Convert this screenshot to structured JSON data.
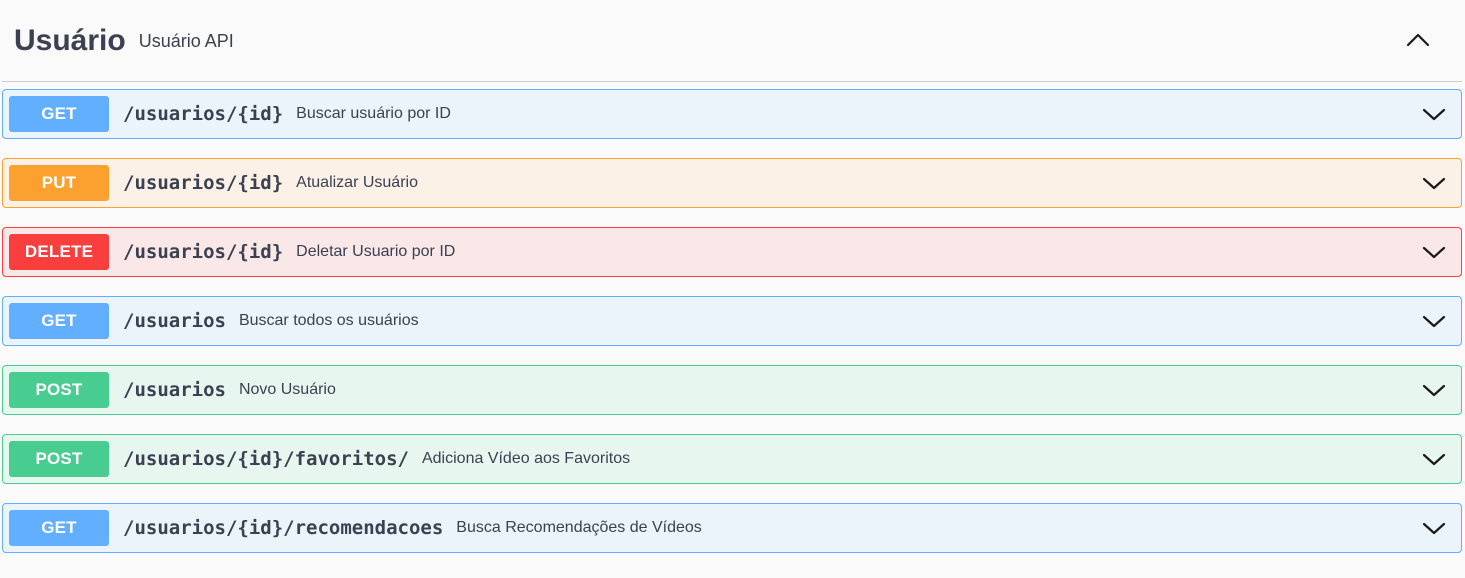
{
  "tag": {
    "name": "Usuário",
    "description": "Usuário API",
    "expanded": true
  },
  "colors": {
    "get": "#61affe",
    "put": "#fca130",
    "delete": "#f93e3e",
    "post": "#49cc90"
  },
  "operations": [
    {
      "method": "GET",
      "path": "/usuarios/{id}",
      "summary": "Buscar usuário por ID"
    },
    {
      "method": "PUT",
      "path": "/usuarios/{id}",
      "summary": "Atualizar Usuário"
    },
    {
      "method": "DELETE",
      "path": "/usuarios/{id}",
      "summary": "Deletar Usuario por ID"
    },
    {
      "method": "GET",
      "path": "/usuarios",
      "summary": "Buscar todos os usuários"
    },
    {
      "method": "POST",
      "path": "/usuarios",
      "summary": "Novo Usuário"
    },
    {
      "method": "POST",
      "path": "/usuarios/{id}/favoritos/",
      "summary": "Adiciona Vídeo aos Favoritos"
    },
    {
      "method": "GET",
      "path": "/usuarios/{id}/recomendacoes",
      "summary": "Busca Recomendações de Vídeos"
    }
  ]
}
